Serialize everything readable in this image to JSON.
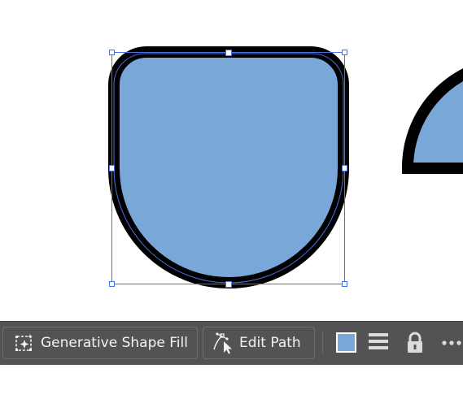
{
  "canvas": {
    "shape_fill": "#78a7d8",
    "shape_stroke": "#000000",
    "selection_color": "#4a6fe0"
  },
  "taskbar": {
    "generative_shape_fill_label": "Generative Shape Fill",
    "edit_path_label": "Edit Path",
    "fill_swatch_color": "#78a7d8",
    "icons": [
      "generative-fill-icon",
      "edit-path-icon",
      "stroke-options-icon",
      "lock-icon",
      "more-options-icon"
    ]
  }
}
